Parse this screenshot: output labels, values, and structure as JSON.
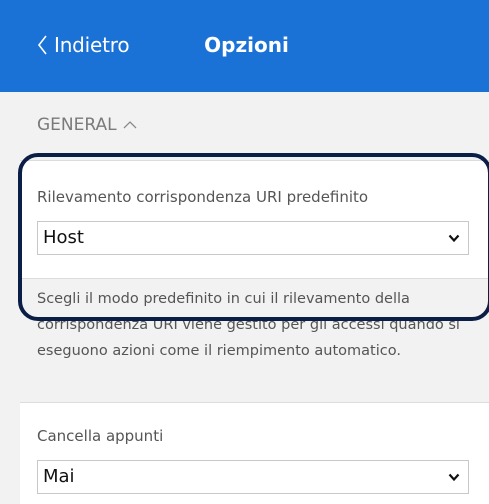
{
  "header": {
    "back_label": "Indietro",
    "title": "Opzioni",
    "background_color": "#1a72d6"
  },
  "section": {
    "title": "GENERAL",
    "caret_icon": "chevron-up-icon"
  },
  "uri_detection": {
    "label": "Rilevamento corrispondenza URI predefinito",
    "selected_value": "Host",
    "help_text": "Scegli il modo predefinito in cui il rilevamento della corrispondenza URI viene gestito per gli accessi quando si eseguono azioni come il riempimento automatico."
  },
  "clear_clipboard": {
    "label": "Cancella appunti",
    "selected_value": "Mai"
  },
  "highlight_color": "#0a1e46"
}
